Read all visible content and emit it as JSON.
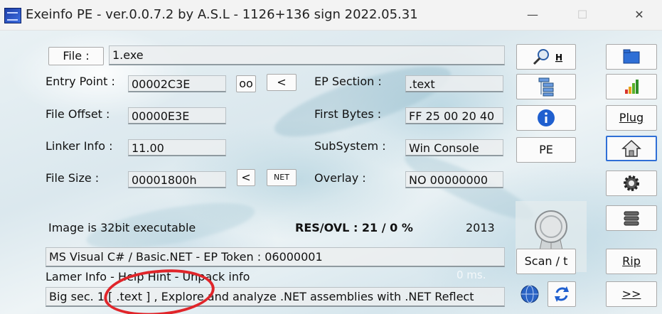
{
  "window": {
    "title": "Exeinfo PE - ver.0.0.7.2  by A.S.L -  1126+136 sign  2022.05.31",
    "minimize": "—",
    "maximize": "☐",
    "close": "✕"
  },
  "file": {
    "button_label": "File :",
    "value": "1.exe"
  },
  "fields": {
    "entry_point_label": "Entry Point :",
    "entry_point_value": "00002C3E",
    "oo_button": "oo",
    "lt_button": "<",
    "ep_section_label": "EP Section :",
    "ep_section_value": ".text",
    "file_offset_label": "File Offset :",
    "file_offset_value": "00000E3E",
    "first_bytes_label": "First Bytes :",
    "first_bytes_value": "FF 25 00 20 40",
    "linker_info_label": "Linker Info :",
    "linker_info_value": "11.00",
    "subsystem_label": "SubSystem :",
    "subsystem_value": "Win Console",
    "file_size_label": "File Size :",
    "file_size_value": "00001800h",
    "size_lt_button": "<",
    "net_button": "NET",
    "overlay_label": "Overlay :",
    "overlay_value": "NO   00000000"
  },
  "status": {
    "image_info": "Image is 32bit executable",
    "res_ovl": "RES/OVL : 21 / 0 %",
    "year": "2013",
    "detection": "MS Visual C# / Basic.NET  - EP Token : 06000001",
    "lamer_info": "Lamer Info - Help Hint - Unpack info",
    "time_ms": "0 ms.",
    "hint": "Big sec. 1 [ .text ] , Explore and analyze .NET assemblies with .NET Reflect"
  },
  "center_buttons": {
    "search_h": "H",
    "pe": "PE",
    "scan": "Scan / t"
  },
  "right_buttons": {
    "plug": "Plug",
    "rip": "Rip",
    "next": ">>"
  },
  "colors": {
    "annotation_ring": "#e0252a",
    "folder_blue": "#2f6fd6",
    "info_blue": "#1f5fcf"
  },
  "icons": [
    "app-icon",
    "magnifier-icon",
    "tree-icon",
    "info-icon",
    "folder-icon",
    "bar-chart-icon",
    "home-icon",
    "gear-icon",
    "stack-icon",
    "ribbon-badge-icon",
    "globe-icon",
    "refresh-icon"
  ]
}
